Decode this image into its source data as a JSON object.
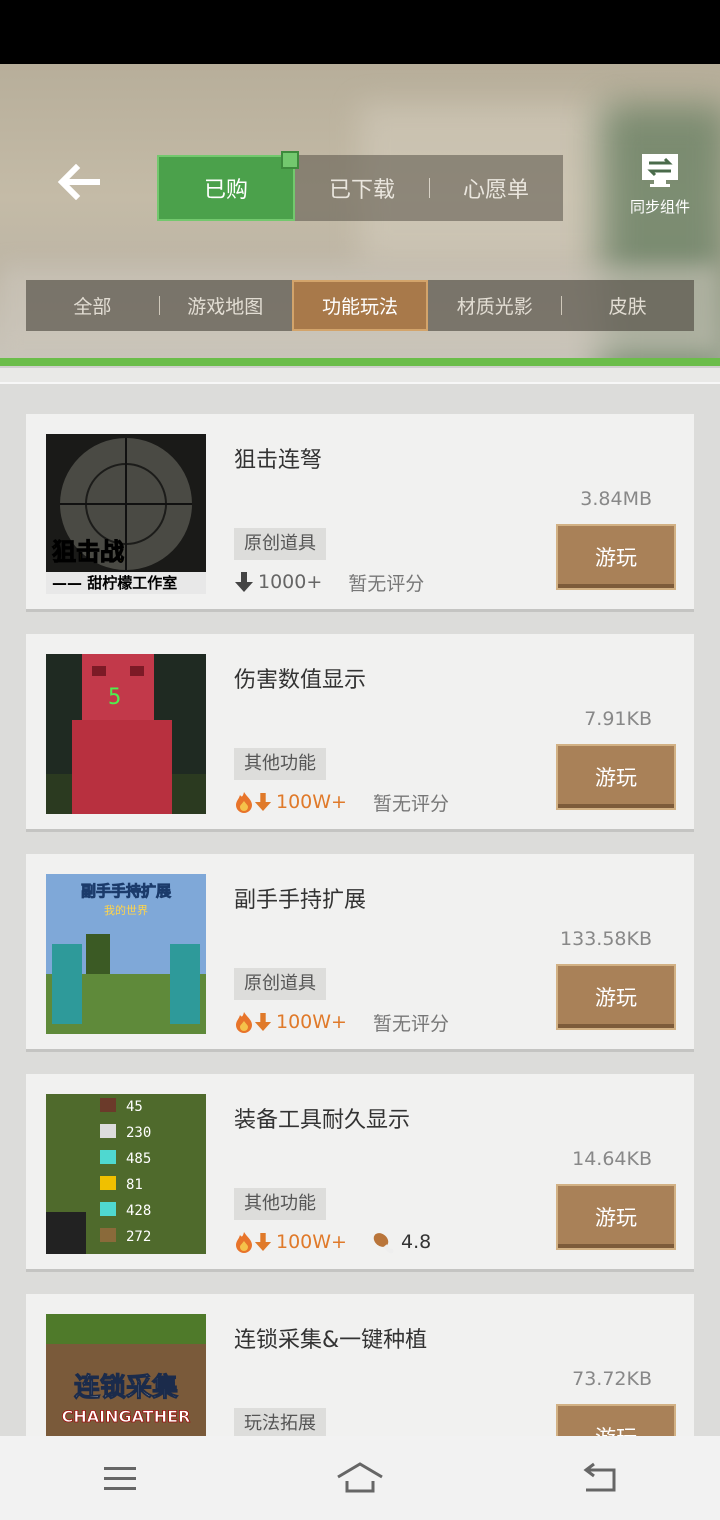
{
  "header": {
    "main_tabs": [
      {
        "label": "已购",
        "active": true
      },
      {
        "label": "已下载",
        "active": false
      },
      {
        "label": "心愿单",
        "active": false
      }
    ],
    "sync_label": "同步组件",
    "sub_tabs": [
      {
        "label": "全部",
        "active": false
      },
      {
        "label": "游戏地图",
        "active": false
      },
      {
        "label": "功能玩法",
        "active": true
      },
      {
        "label": "材质光影",
        "active": false
      },
      {
        "label": "皮肤",
        "active": false
      }
    ]
  },
  "items": [
    {
      "title": "狙击连弩",
      "size": "3.84MB",
      "tag": "原创道具",
      "downloads": "1000+",
      "rating": "暂无评分",
      "play_label": "游玩",
      "thumb_text": [
        "狙击战",
        "—— 甜柠檬工作室"
      ]
    },
    {
      "title": "伤害数值显示",
      "size": "7.91KB",
      "tag": "其他功能",
      "downloads": "100W+",
      "rating": "暂无评分",
      "play_label": "游玩",
      "thumb_text": [
        "5"
      ]
    },
    {
      "title": "副手手持扩展",
      "size": "133.58KB",
      "tag": "原创道具",
      "downloads": "100W+",
      "rating": "暂无评分",
      "play_label": "游玩",
      "thumb_text": [
        "副手手持扩展",
        "我的世界"
      ]
    },
    {
      "title": "装备工具耐久显示",
      "size": "14.64KB",
      "tag": "其他功能",
      "downloads": "100W+",
      "rating": "4.8",
      "play_label": "游玩",
      "thumb_text": [
        "45",
        "230",
        "485",
        "81",
        "428",
        "272"
      ]
    },
    {
      "title": "连锁采集&一键种植",
      "size": "73.72KB",
      "tag": "玩法拓展",
      "downloads": "",
      "rating": "",
      "play_label": "游玩",
      "thumb_text": [
        "连锁采集",
        "CHAINGATHER"
      ]
    }
  ],
  "colors": {
    "accent_green": "#4ba14b",
    "play_brown": "#a98158",
    "hot_orange": "#e07a2a"
  },
  "icons": [
    "back-arrow-icon",
    "sync-icon",
    "download-arrow-icon",
    "fire-icon",
    "drumstick-icon",
    "menu-icon",
    "home-icon",
    "back-icon"
  ]
}
